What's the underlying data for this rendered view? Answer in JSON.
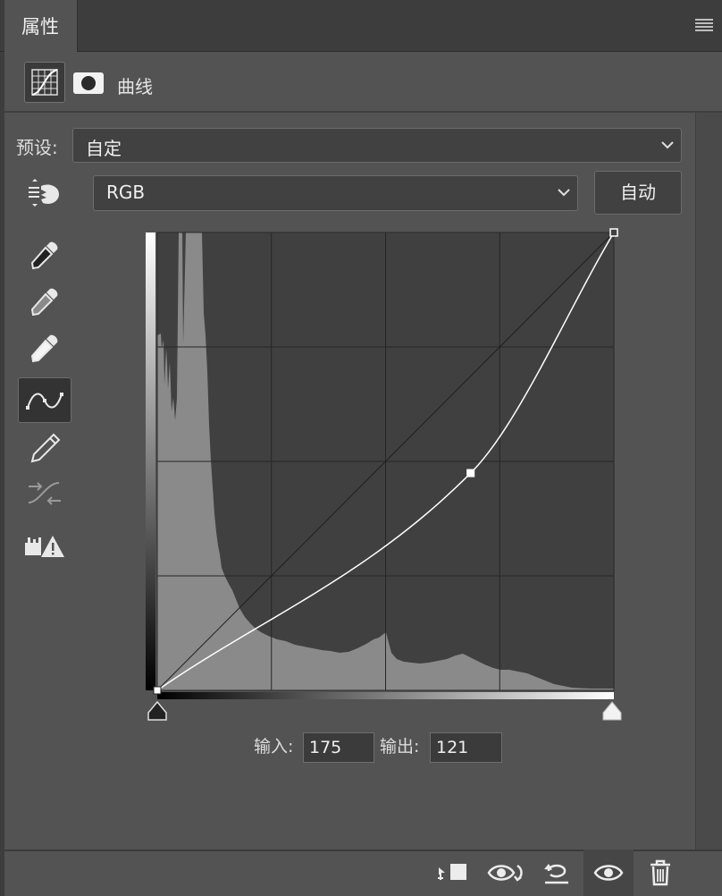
{
  "panel": {
    "tab_title": "属性",
    "adjustment_title": "曲线"
  },
  "preset": {
    "label": "预设:",
    "value": "自定"
  },
  "channel": {
    "value": "RGB",
    "auto_label": "自动"
  },
  "curve": {
    "input_label": "输入:",
    "input_value": "175",
    "output_label": "输出:",
    "output_value": "121"
  },
  "icons": {
    "tools": [
      "hand-target-icon",
      "black-point-eyedropper-icon",
      "gray-point-eyedropper-icon",
      "white-point-eyedropper-icon",
      "curve-points-icon",
      "pencil-icon",
      "smooth-curve-icon",
      "clipping-warning-icon"
    ],
    "footer": [
      "clip-to-layer-icon",
      "view-previous-state-icon",
      "reset-icon",
      "visibility-icon",
      "delete-icon"
    ]
  }
}
